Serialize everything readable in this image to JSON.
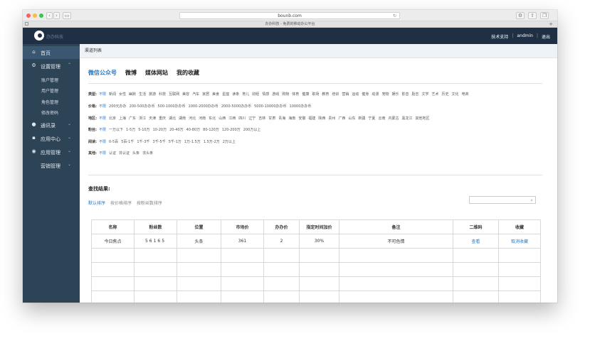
{
  "browser": {
    "url": "bounb.com",
    "tab_title": "办办科技 - 免费的移动办公平台",
    "back": "‹",
    "forward": "›",
    "reload": "↻",
    "plus": "+"
  },
  "header": {
    "logo_text": "办办科技",
    "links": [
      "技术支持",
      "andmin",
      "退出"
    ]
  },
  "sidebar": {
    "home": "首页",
    "settings": "设置管理",
    "settings_sub": [
      "账户管理",
      "用户管理",
      "角色管理",
      "修改密码"
    ],
    "items": [
      "通讯录",
      "应用中心",
      "应用管理",
      "营销管理"
    ]
  },
  "main": {
    "breadcrumb": "渠道列表",
    "tabs": [
      "微信公众号",
      "微博",
      "媒体网站",
      "我的收藏"
    ],
    "filters": [
      {
        "label": "类型:",
        "options": [
          "不限",
          "新闻",
          "女性",
          "幽默",
          "生活",
          "旅游",
          "科技",
          "互联网",
          "美容",
          "汽车",
          "家居",
          "美食",
          "星座",
          "读条",
          "育儿",
          "财经",
          "情感",
          "游戏",
          "购物",
          "体育",
          "健康",
          "职场",
          "教育",
          "培训",
          "营销",
          "运动",
          "健身",
          "动漫",
          "宠物",
          "娱乐",
          "影音",
          "励志",
          "文学",
          "艺术",
          "历史",
          "文化",
          "电商"
        ]
      },
      {
        "label": "价格:",
        "options": [
          "不限",
          "200元办办",
          "200-500办办币",
          "500-1000办办币",
          "1000-2000办办币",
          "2000-5000办办币",
          "5000-10000办办币",
          "10000办办币"
        ]
      },
      {
        "label": "地区:",
        "options": [
          "不限",
          "北京",
          "上海",
          "广东",
          "浙江",
          "天津",
          "重庆",
          "湖北",
          "湖南",
          "河北",
          "河南",
          "东北",
          "山西",
          "江西",
          "四川",
          "辽宁",
          "吉林",
          "甘肃",
          "青海",
          "海南",
          "安徽",
          "福建",
          "陕西",
          "贵州",
          "广西",
          "山东",
          "新疆",
          "宁夏",
          "云南",
          "内蒙古",
          "黑龙江",
          "其他地区"
        ]
      },
      {
        "label": "粉丝:",
        "options": [
          "不限",
          "一万以下",
          "1-5万",
          "5-10万",
          "10-20万",
          "20-40万",
          "40-80万",
          "80-120万",
          "120-200万",
          "200万以上"
        ]
      },
      {
        "label": "阅读:",
        "options": [
          "不限",
          "0-5百",
          "5百-1千",
          "1千-3千",
          "3千-5千",
          "5千-1万",
          "1万-1.5万",
          "1.5万-2万",
          "2万以上"
        ]
      },
      {
        "label": "其他:",
        "options": [
          "不限",
          "认证",
          "非认证",
          "头条",
          "非头条"
        ]
      }
    ],
    "results_title": "查找结果:",
    "sorts": [
      "默认排序",
      "按价格排序",
      "按粉丝数排序"
    ],
    "search_placeholder": "",
    "search_icon": "🔍",
    "table": {
      "headers": [
        "名称",
        "粉丝数",
        "位置",
        "市场价",
        "办办价",
        "指定时间加价",
        "备注",
        "二维码",
        "收藏"
      ],
      "rows": [
        [
          "今日焦点",
          "56165",
          "头条",
          "361",
          "2",
          "30%",
          "不可色情",
          "查看",
          "取消收藏"
        ]
      ]
    }
  }
}
